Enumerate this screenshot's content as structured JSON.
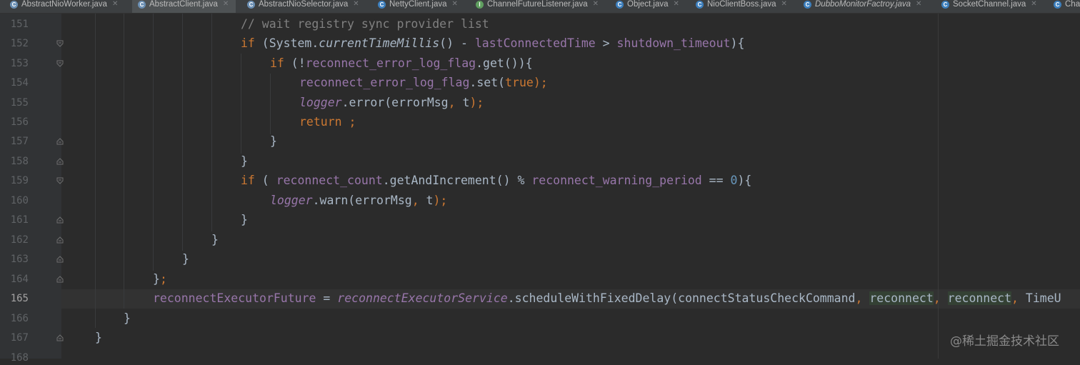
{
  "tabs": [
    {
      "label": "AbstractNioWorker.java",
      "icon": "abstract-class-icon"
    },
    {
      "label": "AbstractClient.java",
      "icon": "abstract-class-icon",
      "active": true
    },
    {
      "label": "AbstractNioSelector.java",
      "icon": "abstract-class-icon"
    },
    {
      "label": "NettyClient.java",
      "icon": "class-icon"
    },
    {
      "label": "ChannelFutureListener.java",
      "icon": "interface-icon"
    },
    {
      "label": "Object.java",
      "icon": "class-icon"
    },
    {
      "label": "NioClientBoss.java",
      "icon": "class-icon"
    },
    {
      "label": "DubboMonitorFactroy.java",
      "icon": "class-icon"
    },
    {
      "label": "SocketChannel.java",
      "icon": "class-icon"
    },
    {
      "label": "Cha",
      "icon": "class-icon"
    }
  ],
  "lines": [
    "151",
    "152",
    "153",
    "154",
    "155",
    "156",
    "157",
    "158",
    "159",
    "160",
    "161",
    "162",
    "163",
    "164",
    "165",
    "166",
    "167",
    "168"
  ],
  "current_line": "165",
  "code": {
    "l151": "// wait registry sync provider list",
    "l152": [
      "if",
      " (System.",
      "currentTimeMillis",
      "() - ",
      "lastConnectedTime",
      " > ",
      "shutdown_timeout",
      ")",
      "{"
    ],
    "l153": [
      "if",
      " (!",
      "reconnect_error_log_flag",
      ".get())",
      "{"
    ],
    "l154": [
      "reconnect_error_log_flag",
      ".set(",
      "true",
      ");"
    ],
    "l155": [
      "logger",
      ".error(errorMsg",
      ",",
      " t",
      ");"
    ],
    "l156": [
      "return ;"
    ],
    "l157": "}",
    "l158": "}",
    "l159": [
      "if",
      " ( ",
      "reconnect_count",
      ".getAndIncrement() % ",
      "reconnect_warning_period",
      " == ",
      "0",
      ")",
      "{"
    ],
    "l160": [
      "logger",
      ".warn(errorMsg",
      ",",
      " t",
      ");"
    ],
    "l161": "}",
    "l162": "}",
    "l163": "}",
    "l164": [
      "}",
      ";"
    ],
    "l165": [
      "reconnectExecutorFuture",
      " = ",
      "reconnectExecutorService",
      ".scheduleWithFixedDelay(connectStatusCheckCommand",
      ", ",
      "reconnect",
      ", ",
      "reconnect",
      ", ",
      "TimeU"
    ],
    "l166": "}",
    "l167": "}"
  },
  "watermark": "@稀土掘金技术社区",
  "colors": {
    "background": "#2b2b2b",
    "keyword": "#cc7832",
    "field": "#9876aa",
    "comment": "#808080",
    "number": "#6897bb",
    "text": "#a9b7c6"
  }
}
